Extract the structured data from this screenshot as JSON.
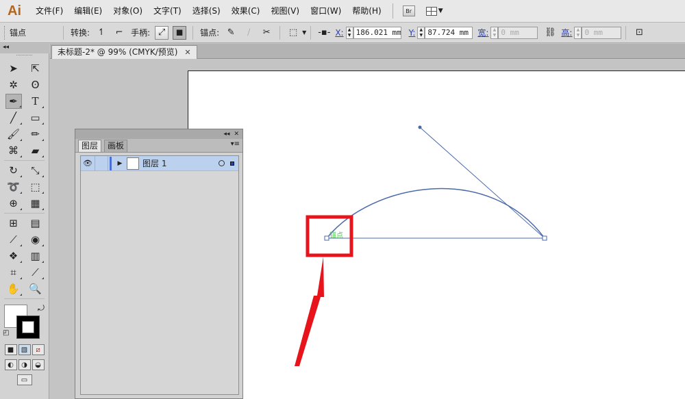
{
  "app": {
    "logo": "Ai"
  },
  "menu": [
    "文件(F)",
    "编辑(E)",
    "对象(O)",
    "文字(T)",
    "选择(S)",
    "效果(C)",
    "视图(V)",
    "窗口(W)",
    "帮助(H)"
  ],
  "menu_extra": {
    "bridge": "Br"
  },
  "control": {
    "selection_label": "锚点",
    "convert_label": "转换:",
    "handles_label": "手柄:",
    "anchor_label": "锚点:",
    "x_label": "X:",
    "x_value": "186.021 mm",
    "y_label": "Y:",
    "y_value": "87.724 mm",
    "w_label": "宽:",
    "w_value": "0 mm",
    "h_label": "高:",
    "h_value": "0 mm"
  },
  "document": {
    "tab_title": "未标题-2* @ 99% (CMYK/预览)",
    "close": "✕"
  },
  "canvas": {
    "anchor_hint": "锚点"
  },
  "layers_panel": {
    "tabs": [
      "图层",
      "画板"
    ],
    "layers": [
      {
        "name": "图层 1"
      }
    ]
  },
  "colors": {
    "highlight": "#e8141c",
    "path": "#4a6aa8",
    "layer_row": "#bcd1ee",
    "layer_color": "#4a6fd6"
  }
}
